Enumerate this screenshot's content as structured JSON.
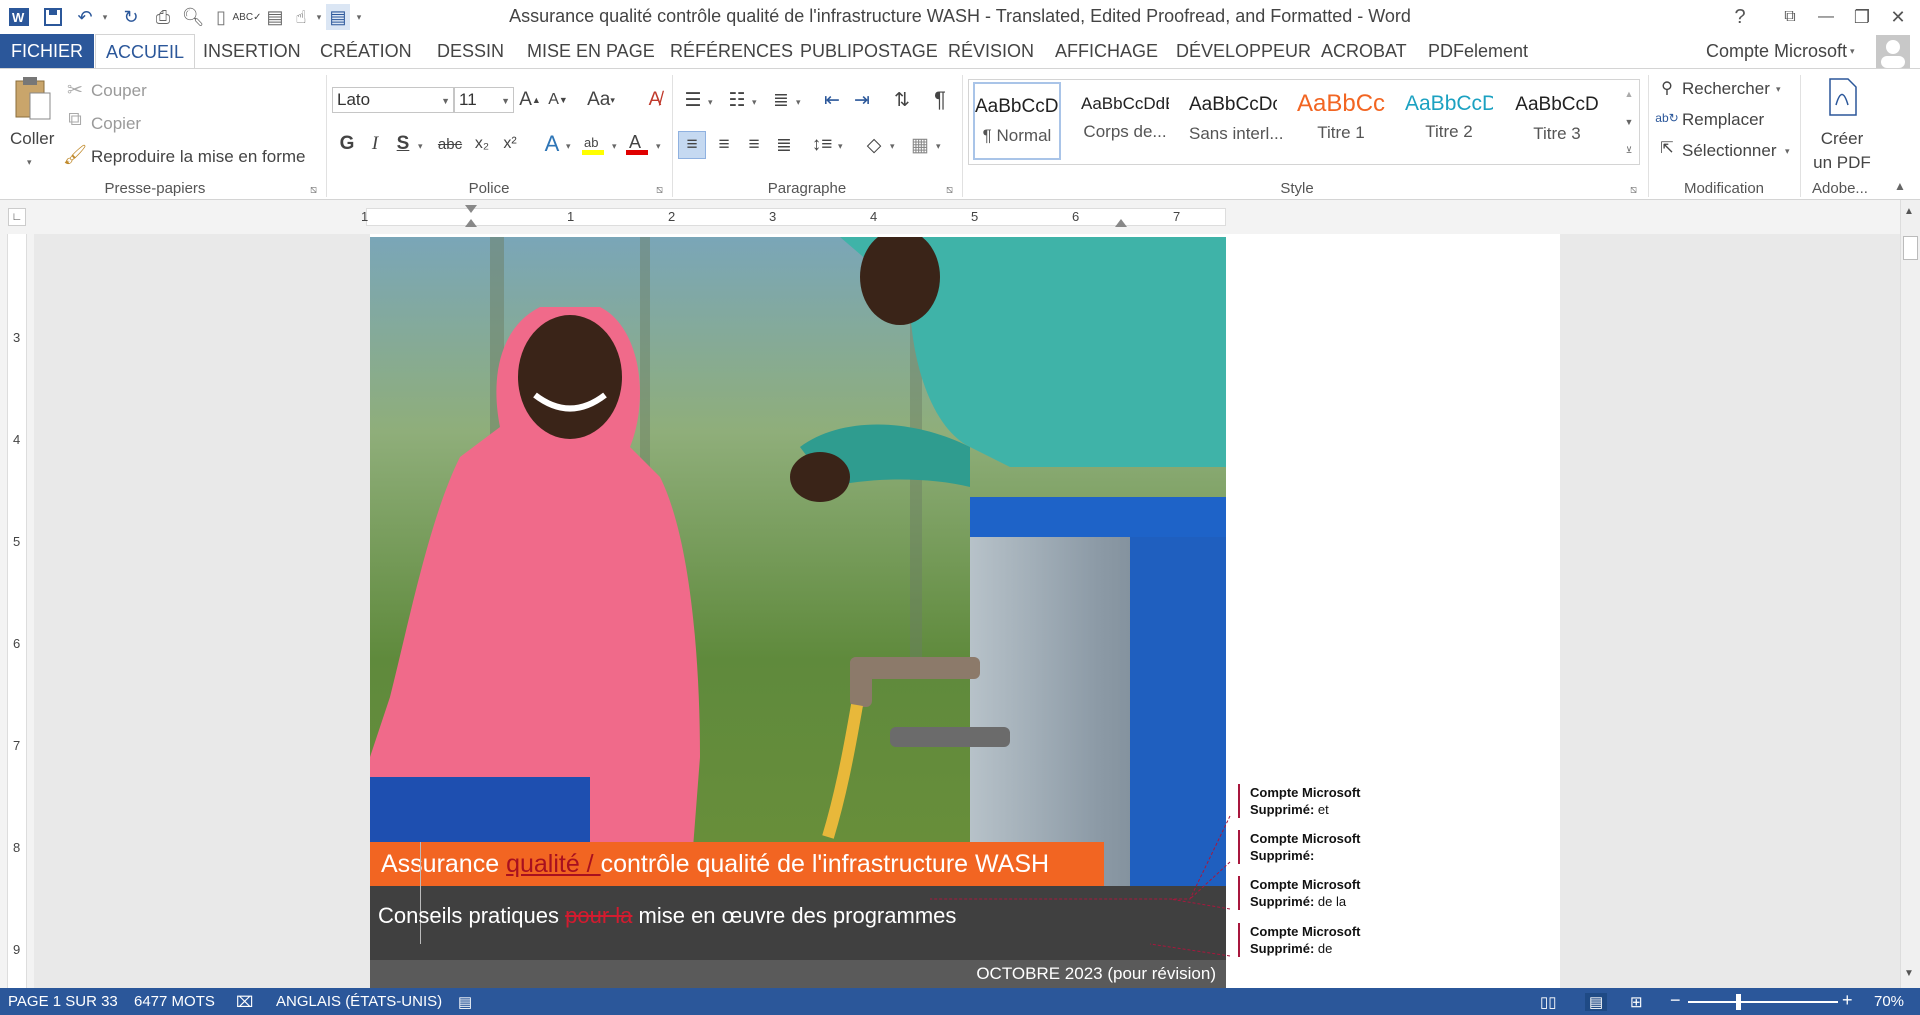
{
  "window": {
    "title": "Assurance qualité  contrôle qualité de l'infrastructure WASH - Translated, Edited Proofread, and Formatted - Word"
  },
  "titlebar_buttons": {
    "help": "?",
    "ribbon_display": "⧉",
    "minimize": "—",
    "restore": "❐",
    "close": "✕"
  },
  "tabs": [
    "FICHIER",
    "ACCUEIL",
    "INSERTION",
    "CRÉATION",
    "DESSIN",
    "MISE EN PAGE",
    "RÉFÉRENCES",
    "PUBLIPOSTAGE",
    "RÉVISION",
    "AFFICHAGE",
    "DÉVELOPPEUR",
    "ACROBAT",
    "PDFelement"
  ],
  "account": {
    "name": "Compte Microsoft"
  },
  "ribbon": {
    "clipboard": {
      "paste_label": "Coller",
      "cut_label": "Couper",
      "copy_label": "Copier",
      "format_painter_label": "Reproduire la mise en forme",
      "group_label": "Presse-papiers"
    },
    "font": {
      "font_name": "Lato",
      "font_size": "11",
      "group_label": "Police",
      "bold": "G",
      "italic": "I",
      "underline": "S",
      "strike": "abc",
      "subscript": "x₂",
      "superscript": "x²",
      "case": "Aa"
    },
    "paragraph": {
      "group_label": "Paragraphe"
    },
    "styles": {
      "group_label": "Style",
      "items": [
        {
          "preview": "AaBbCcDc",
          "name": "¶ Normal"
        },
        {
          "preview": "AaBbCcDdE",
          "name": "Corps de..."
        },
        {
          "preview": "AaBbCcDc",
          "name": "Sans interl..."
        },
        {
          "preview": "AaBbCc",
          "name": "Titre 1"
        },
        {
          "preview": "AaBbCcD",
          "name": "Titre 2"
        },
        {
          "preview": "AaBbCcD",
          "name": "Titre 3"
        }
      ]
    },
    "editing": {
      "group_label": "Modification",
      "find_label": "Rechercher",
      "replace_label": "Remplacer",
      "select_label": "Sélectionner"
    },
    "adobe": {
      "group_label": "Adobe...",
      "create_pdf_line1": "Créer",
      "create_pdf_line2": "un PDF"
    }
  },
  "ruler": {
    "numbers": [
      "1",
      "1",
      "2",
      "3",
      "4",
      "5",
      "6",
      "7"
    ],
    "vnumbers": [
      "3",
      "4",
      "5",
      "6",
      "7",
      "8",
      "9"
    ]
  },
  "document": {
    "title_part1": "Assurance ",
    "title_deleted": "qualité / ",
    "title_part2": "contrôle qualité de l'infrastructure WASH",
    "subtitle_part1": "Conseils pratiques ",
    "subtitle_deleted": "pour la",
    "subtitle_part2": " mise en œuvre des programmes",
    "date": "OCTOBRE 2023 (pour révision)"
  },
  "comments": [
    {
      "author": "Compte Microsoft",
      "label": "Supprimé:",
      "text": " et"
    },
    {
      "author": "Compte Microsoft",
      "label": "Supprimé:",
      "text": ""
    },
    {
      "author": "Compte Microsoft",
      "label": "Supprimé:",
      "text": "  de la"
    },
    {
      "author": "Compte Microsoft",
      "label": "Supprimé:",
      "text": " de"
    }
  ],
  "statusbar": {
    "page": "PAGE 1 SUR 33",
    "words": "6477 MOTS",
    "language": "ANGLAIS (ÉTATS-UNIS)",
    "zoom": "70%",
    "zoom_level_percent": 70
  },
  "colors": {
    "accent": "#2b579a",
    "title_band": "#f26522",
    "subtitle_band": "#404040",
    "date_band": "#5a5a5a",
    "revision_mark": "#a8173d"
  }
}
